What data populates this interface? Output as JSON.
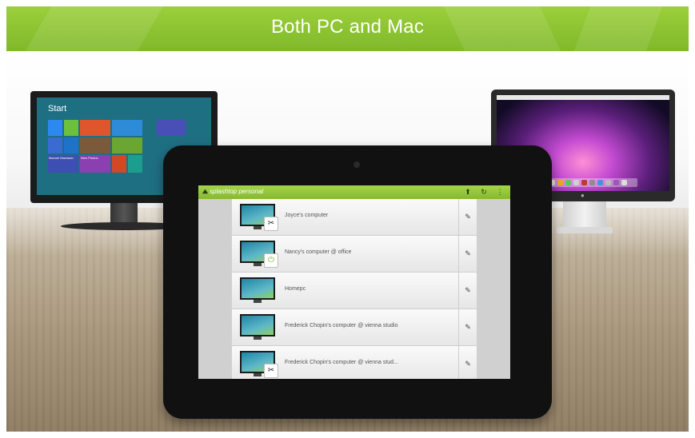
{
  "banner": {
    "title": "Both PC and Mac"
  },
  "pc_screen": {
    "start_label": "Start",
    "tile_people": "Manuel Machado",
    "tile_new_photos": "New Photos"
  },
  "app": {
    "brand": "splashtop personal",
    "icons": {
      "upload": "upload-icon",
      "refresh": "refresh-icon",
      "menu": "overflow-menu-icon"
    },
    "computers": [
      {
        "name": "Joyce's computer",
        "badge": "✂"
      },
      {
        "name": "Nancy's computer @ office",
        "badge": "⏻"
      },
      {
        "name": "Homepc",
        "badge": ""
      },
      {
        "name": "Frederick Chopin's computer @ vienna studio",
        "badge": ""
      },
      {
        "name": "Frederick Chopin's computer @ vienna stud...",
        "badge": "✂"
      }
    ]
  },
  "colors": {
    "brand_green": "#8cc63f"
  }
}
